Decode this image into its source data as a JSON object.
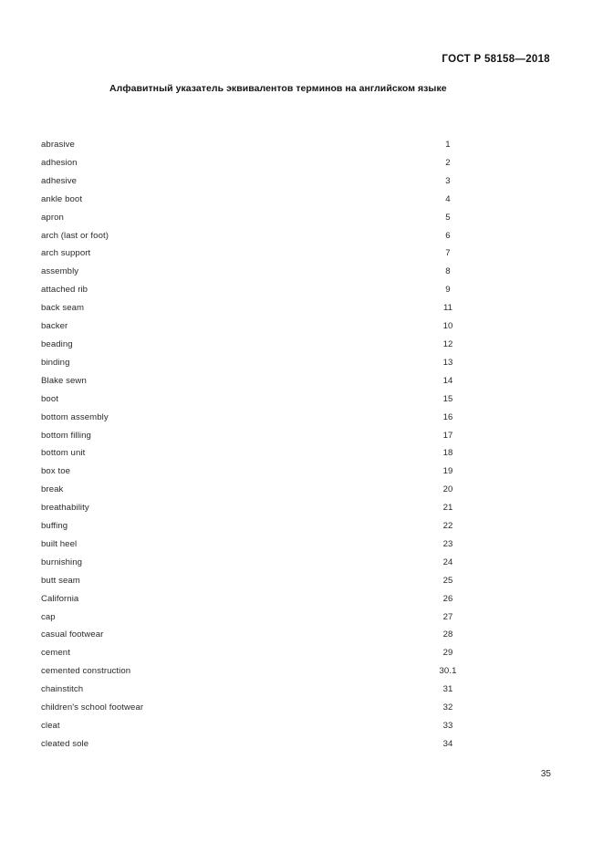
{
  "document": {
    "standard_header": "ГОСТ Р 58158—2018",
    "index_title": "Алфавитный указатель эквивалентов терминов на английском языке",
    "folio": "35"
  },
  "index": {
    "entries": [
      {
        "term": "abrasive",
        "ref": "1"
      },
      {
        "term": "adhesion",
        "ref": "2"
      },
      {
        "term": "adhesive",
        "ref": "3"
      },
      {
        "term": "ankle boot",
        "ref": "4"
      },
      {
        "term": "apron",
        "ref": "5"
      },
      {
        "term": "arch (last or foot)",
        "ref": "6"
      },
      {
        "term": "arch support",
        "ref": "7"
      },
      {
        "term": "assembly",
        "ref": "8"
      },
      {
        "term": "attached rib",
        "ref": "9"
      },
      {
        "term": "back seam",
        "ref": "11"
      },
      {
        "term": "backer",
        "ref": "10"
      },
      {
        "term": "beading",
        "ref": "12"
      },
      {
        "term": "binding",
        "ref": "13"
      },
      {
        "term": "Blake sewn",
        "ref": "14"
      },
      {
        "term": "boot",
        "ref": "15"
      },
      {
        "term": "bottom assembly",
        "ref": "16"
      },
      {
        "term": "bottom filling",
        "ref": "17"
      },
      {
        "term": "bottom unit",
        "ref": "18"
      },
      {
        "term": "box toe",
        "ref": "19"
      },
      {
        "term": "break",
        "ref": "20"
      },
      {
        "term": "breathability",
        "ref": "21"
      },
      {
        "term": "buffing",
        "ref": "22"
      },
      {
        "term": "built heel",
        "ref": "23"
      },
      {
        "term": "burnishing",
        "ref": "24"
      },
      {
        "term": "butt seam",
        "ref": "25"
      },
      {
        "term": "California",
        "ref": "26"
      },
      {
        "term": "cap",
        "ref": "27"
      },
      {
        "term": "casual footwear",
        "ref": "28"
      },
      {
        "term": "cement",
        "ref": "29"
      },
      {
        "term": "cemented construction",
        "ref": "30.1"
      },
      {
        "term": "chainstitch",
        "ref": "31"
      },
      {
        "term": "children's school footwear",
        "ref": "32"
      },
      {
        "term": "cleat",
        "ref": "33"
      },
      {
        "term": "cleated sole",
        "ref": "34"
      }
    ]
  }
}
